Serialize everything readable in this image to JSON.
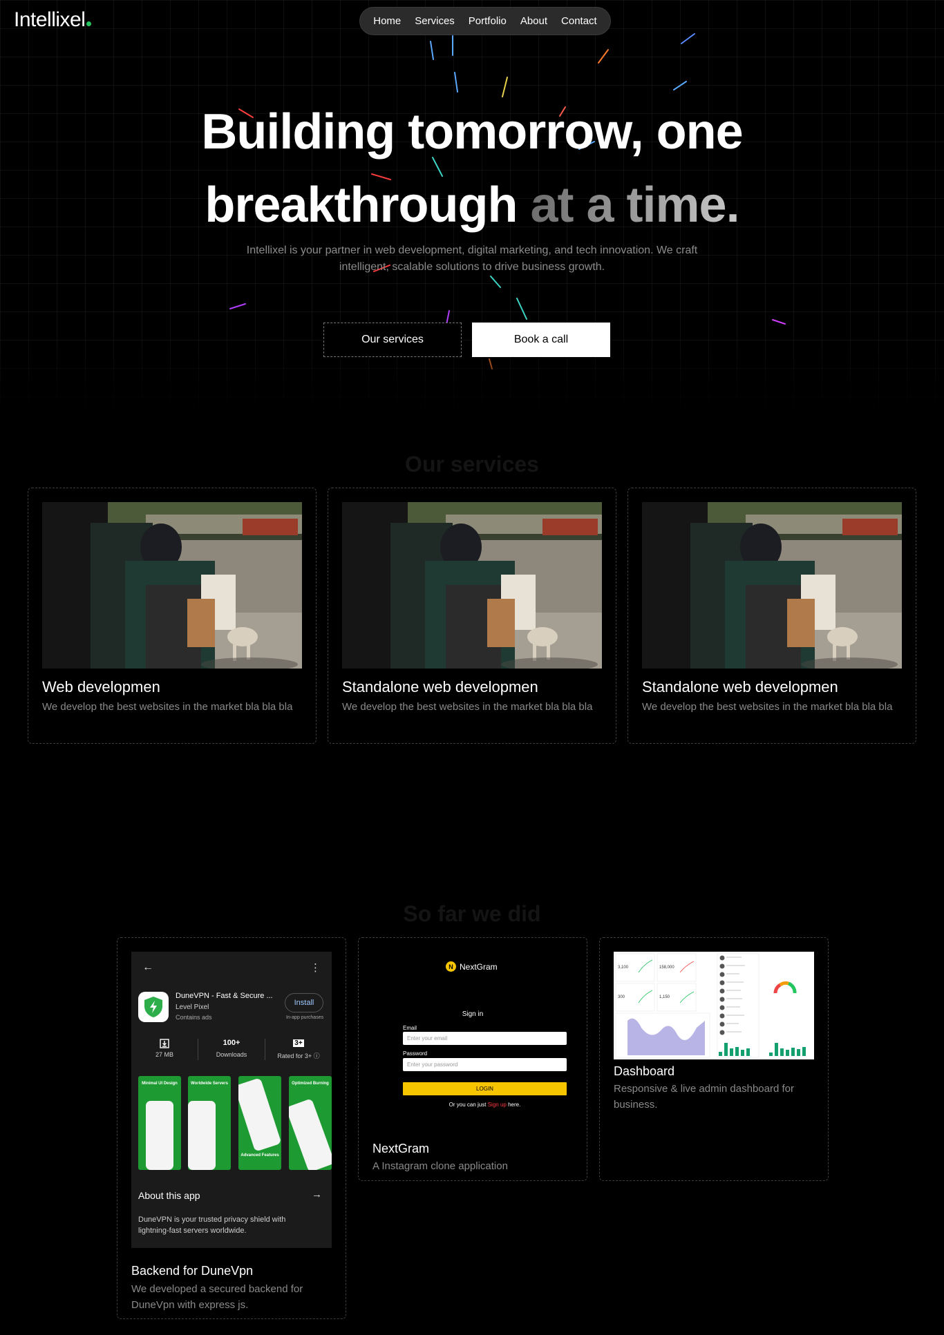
{
  "brand": {
    "name": "Intellixel"
  },
  "nav": {
    "items": [
      "Home",
      "Services",
      "Portfolio",
      "About",
      "Contact"
    ]
  },
  "hero": {
    "headline_line1": "Building tomorrow, one",
    "headline_line2_main": "breakthrough",
    "headline_line2_fade": "at a time.",
    "subtitle": "Intellixel is your partner in web development, digital marketing, and tech innovation. We craft intelligent, scalable solutions to drive business growth.",
    "btn_services": "Our services",
    "btn_call": "Book a call"
  },
  "services": {
    "title": "Our services",
    "cards": [
      {
        "title": "Web developmen",
        "description": "We develop the best websites in the market bla bla bla"
      },
      {
        "title": "Standalone web developmen",
        "description": "We develop the best websites in the market bla bla bla"
      },
      {
        "title": "Standalone web developmen",
        "description": "We develop the best websites in the market bla bla bla"
      }
    ]
  },
  "work": {
    "title": "So far we did",
    "projects": [
      {
        "title": "Backend for DuneVpn",
        "description": "We developed a secured backend for DuneVpn with express js.",
        "mockup": {
          "app_name": "DuneVPN - Fast & Secure ...",
          "developer": "Level Pixel",
          "ads": "Contains ads",
          "install": "Install",
          "iap": "In-app purchases",
          "stats": [
            {
              "top": "",
              "bottom": "27 MB"
            },
            {
              "top": "100+",
              "bottom": "Downloads"
            },
            {
              "top": "3+",
              "bottom": "Rated for 3+ ⓘ"
            }
          ],
          "screenshots": [
            "Minimal UI Design",
            "Worldwide Servers",
            "",
            "Optimized Burning"
          ],
          "screenshot_caption": "Advanced Features",
          "about": "About this app",
          "about_desc": "DuneVPN is your trusted privacy shield with lightning-fast servers worldwide."
        }
      },
      {
        "title": "NextGram",
        "description": "A Instagram clone application",
        "mockup": {
          "logo_letter": "N",
          "logo": "NextGram",
          "signin": "Sign in",
          "email_label": "Email",
          "email_placeholder": "Enter your email",
          "password_label": "Password",
          "password_placeholder": "Enter your password",
          "login": "LOGIN",
          "or_prefix": "Or you can just",
          "signup": "Sign up",
          "or_suffix": "here."
        }
      },
      {
        "title": "Dashboard",
        "description": "Responsive & live admin dashboard for business.",
        "mockup": {
          "kpi_values": [
            "3,100",
            "158,000",
            "300",
            "1,150"
          ]
        }
      }
    ]
  },
  "colors": {
    "accent_dot": "#22c55e",
    "nextgram_yellow": "#f7c400",
    "dashboard_green": "#14a06e",
    "dashboard_area": "#b9b4e6"
  }
}
